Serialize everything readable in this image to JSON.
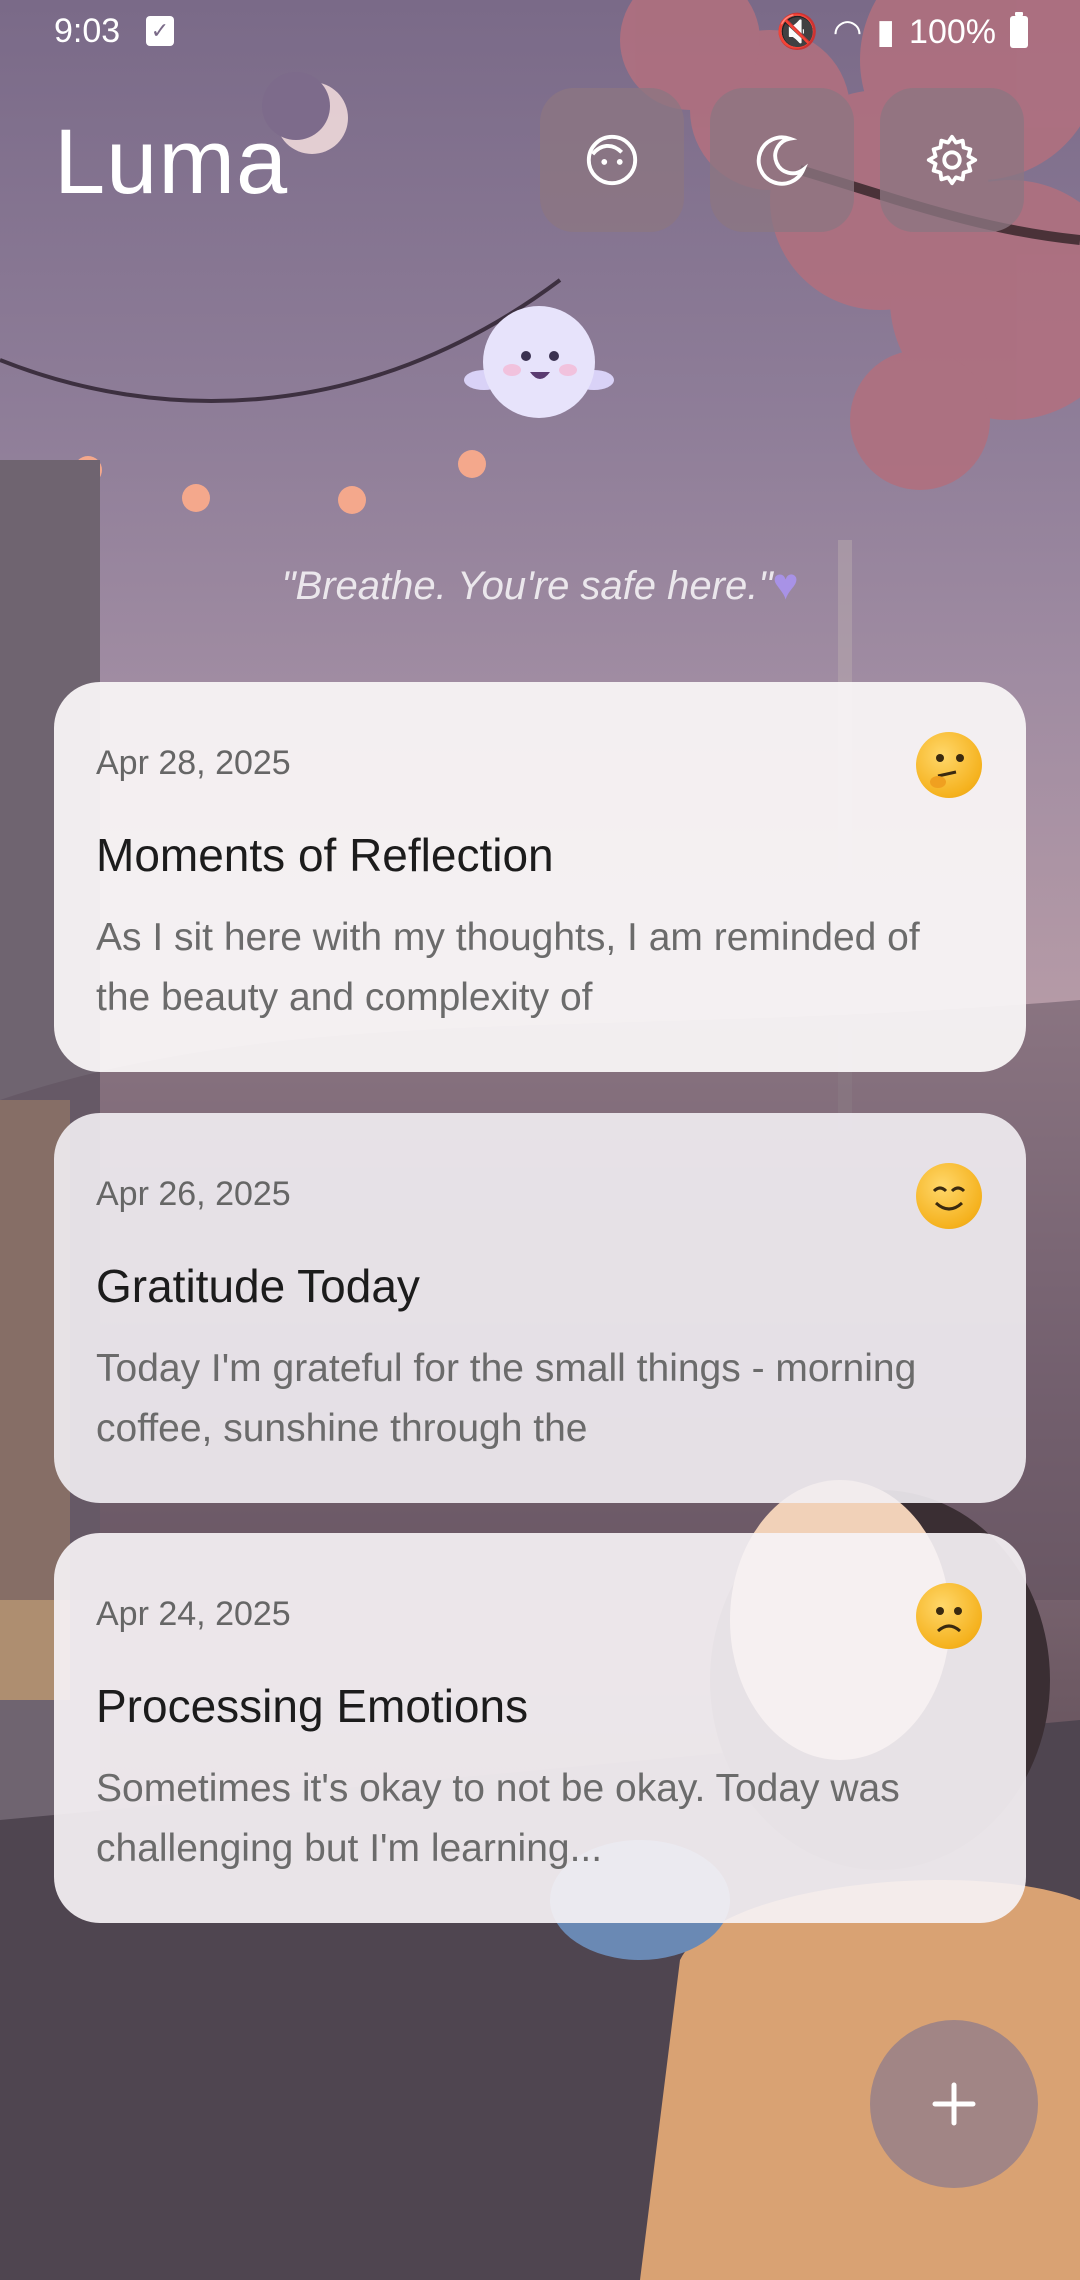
{
  "status": {
    "time": "9:03",
    "battery": "100%"
  },
  "app": {
    "title": "Luma"
  },
  "header": {
    "buttons": [
      {
        "icon": "face-icon"
      },
      {
        "icon": "moon-icon"
      },
      {
        "icon": "gear-icon"
      }
    ]
  },
  "quote": {
    "text": "\"Breathe. You're safe here.\""
  },
  "entries": [
    {
      "date": "Apr 28, 2025",
      "title": "Moments of Reflection",
      "excerpt": "As I sit here with my thoughts, I am reminded of the beauty and complexity of",
      "mood": "thinking-face-icon"
    },
    {
      "date": "Apr 26, 2025",
      "title": "Gratitude Today",
      "excerpt": "Today I'm grateful for the small things - morning coffee, sunshine through the",
      "mood": "smiling-face-icon"
    },
    {
      "date": "Apr 24, 2025",
      "title": "Processing Emotions",
      "excerpt": "Sometimes it's okay to not be okay. Today was challenging but I'm learning...",
      "mood": "worried-face-icon"
    }
  ],
  "fab": {
    "icon": "plus-icon"
  }
}
